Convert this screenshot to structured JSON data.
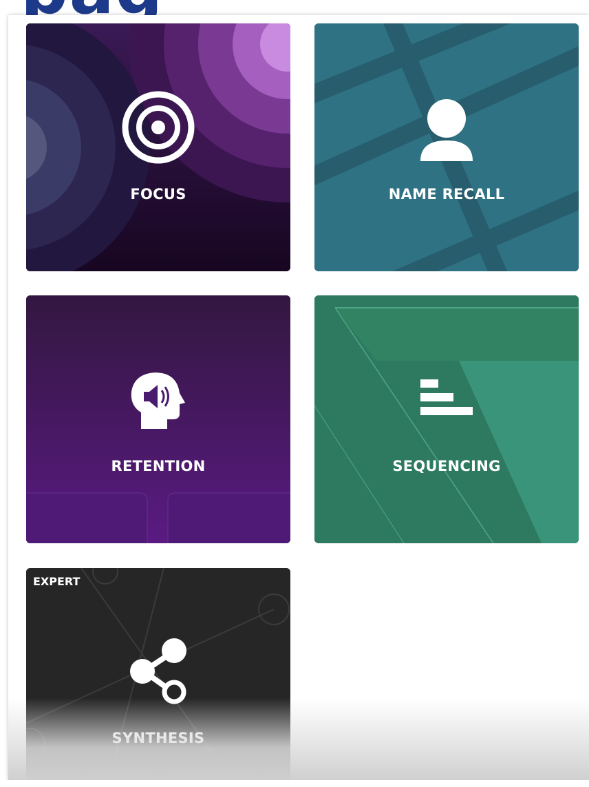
{
  "header": {
    "fragment_text": "pag"
  },
  "tiles": [
    {
      "label": "FOCUS",
      "icon": "target-icon",
      "color": "#2b1240"
    },
    {
      "label": "NAME RECALL",
      "icon": "person-icon",
      "color": "#2f6f80"
    },
    {
      "label": "RETENTION",
      "icon": "head-speaker-icon",
      "color": "#4a1a6e"
    },
    {
      "label": "SEQUENCING",
      "icon": "bars-icon",
      "color": "#2e7a62"
    },
    {
      "label": "SYNTHESIS",
      "icon": "share-icon",
      "color": "#2a2a2a",
      "tag": "EXPERT"
    }
  ]
}
